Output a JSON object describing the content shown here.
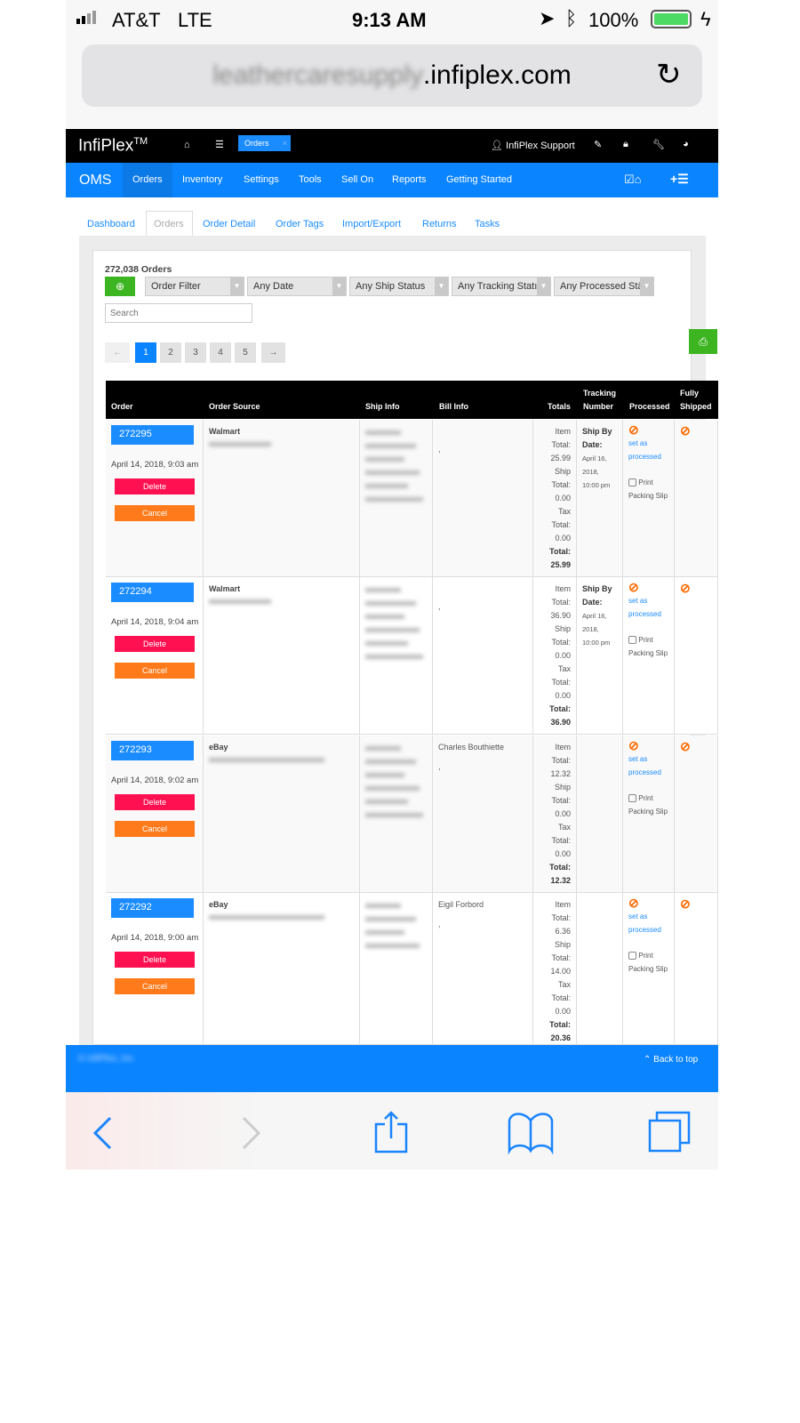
{
  "status_bar": {
    "carrier": "AT&T",
    "network": "LTE",
    "time": "9:13 AM",
    "battery": "100%"
  },
  "browser": {
    "url_domain": ".infiplex.com"
  },
  "top_bar": {
    "brand": "InfiPlex",
    "brand_tm": "TM",
    "open_tab": "Orders",
    "user": "InfiPlex Support"
  },
  "main_nav": {
    "app": "OMS",
    "items": [
      "Orders",
      "Inventory",
      "Settings",
      "Tools",
      "Sell On",
      "Reports",
      "Getting Started"
    ],
    "active": "Orders"
  },
  "sub_tabs": {
    "items": [
      "Dashboard",
      "Orders",
      "Order Detail",
      "Order Tags",
      "Import/Export",
      "Returns",
      "Tasks"
    ],
    "active": "Orders"
  },
  "orders": {
    "count_label": "272,038 Orders",
    "filters": [
      "Order Filter",
      "Any Date",
      "Any Ship Status",
      "Any Tracking Statı",
      "Any Processed Stā"
    ],
    "search_placeholder": "Search",
    "pagination": [
      "←",
      "1",
      "2",
      "3",
      "4",
      "5",
      "→"
    ],
    "active_page": "1",
    "columns": [
      "Order",
      "Order Source",
      "Ship Info",
      "Bill Info",
      "Totals",
      "Tracking",
      "Number",
      "Processed",
      "Fully",
      "Shipped"
    ],
    "rows": [
      {
        "id": "272295",
        "date": "April 14, 2018, 9:03 am",
        "source": "Walmart",
        "bill": "",
        "bill_extra": ",",
        "item_total": "25.99",
        "ship_total": "0.00",
        "tax_total": "0.00",
        "total": "25.99",
        "ship_by": "Ship By",
        "ship_by2": "Date:",
        "ship_date": [
          "April 16,",
          "2018,",
          "10:00 pm"
        ]
      },
      {
        "id": "272294",
        "date": "April 14, 2018, 9:04 am",
        "source": "Walmart",
        "bill": "",
        "bill_extra": ",",
        "item_total": "36.90",
        "ship_total": "0.00",
        "tax_total": "0.00",
        "total": "36.90",
        "ship_by": "Ship By",
        "ship_by2": "Date:",
        "ship_date": [
          "April 16,",
          "2018,",
          "10:00 pm"
        ]
      },
      {
        "id": "272293",
        "date": "April 14, 2018, 9:02 am",
        "source": "eBay",
        "bill": "Charles Bouthiette",
        "bill_extra": ",",
        "item_total": "12.32",
        "ship_total": "0.00",
        "tax_total": "0.00",
        "total": "12.32"
      },
      {
        "id": "272292",
        "date": "April 14, 2018, 9:00 am",
        "source": "eBay",
        "bill": "Eigil Forbord",
        "bill_extra": ",",
        "item_total": "6.36",
        "ship_total": "14.00",
        "tax_total": "0.00",
        "total": "20.36"
      }
    ],
    "labels": {
      "delete": "Delete",
      "cancel": "Cancel",
      "item": "Item",
      "ship": "Ship",
      "tax": "Tax",
      "total_colon": "Total:",
      "set_as": "set as",
      "processed": "processed",
      "print": "Print",
      "packing_slip": "Packing Slip"
    }
  },
  "footer": {
    "copyright": "© InfiPlex, Inc",
    "back_to_top": "Back to top"
  },
  "colors": {
    "primary": "#0a84ff",
    "danger": "#ff1050",
    "warning": "#ff7a1a",
    "success": "#3cb521"
  }
}
